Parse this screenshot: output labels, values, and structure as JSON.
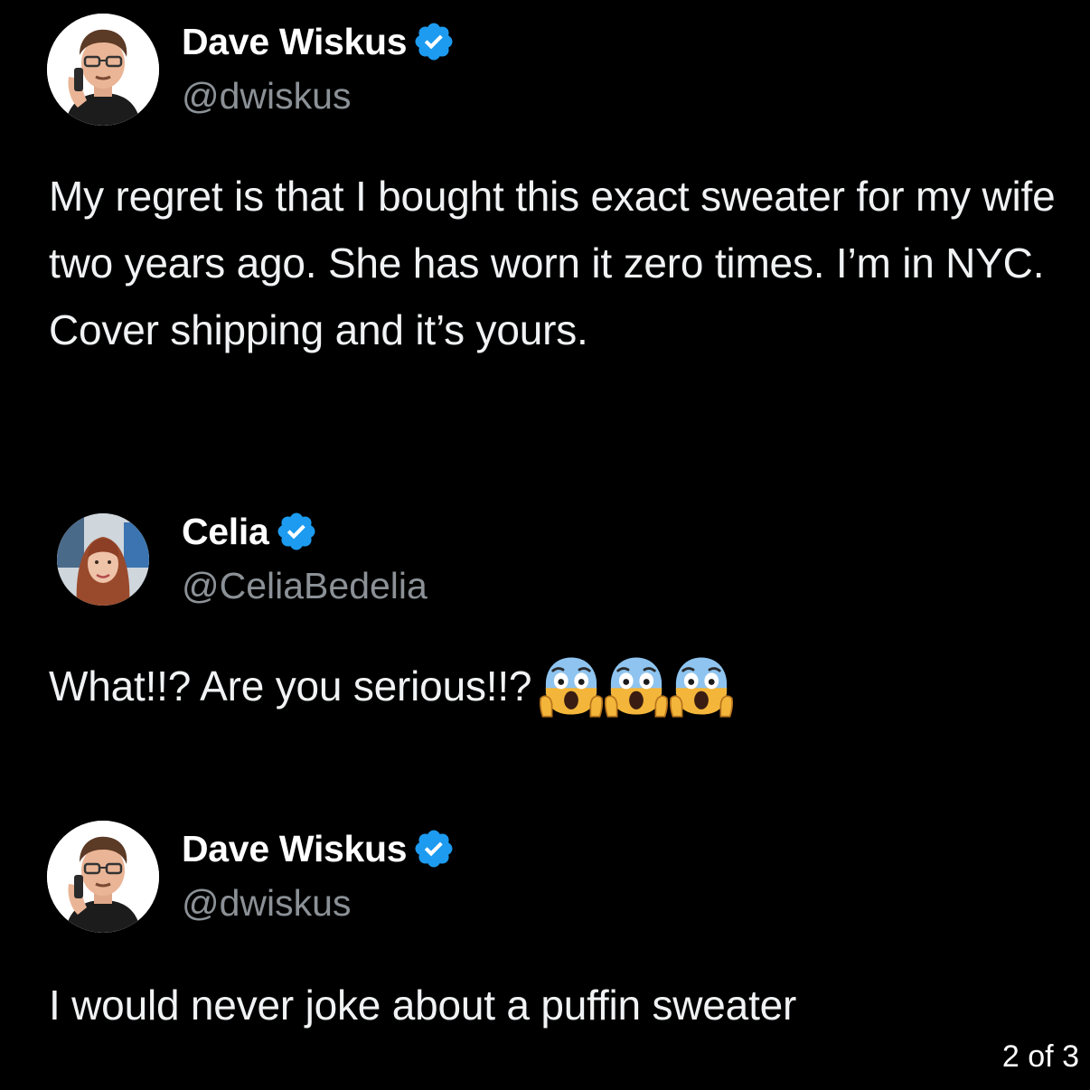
{
  "tweets": [
    {
      "author_name": "Dave Wiskus",
      "handle": "@dwiskus",
      "verified": true,
      "avatar_icon": "man-with-glasses-on-phone-avatar",
      "text": "My regret is that I bought this exact sweater for my wife two years ago. She has worn it zero times. I’m in NYC. Cover shipping and it’s yours."
    },
    {
      "author_name": "Celia",
      "handle": "@CeliaBedelia",
      "verified": true,
      "avatar_icon": "woman-with-red-hair-avatar",
      "text": "What!!? Are you serious!!?",
      "emojis": [
        "face-screaming-in-fear-icon",
        "face-screaming-in-fear-icon",
        "face-screaming-in-fear-icon"
      ]
    },
    {
      "author_name": "Dave Wiskus",
      "handle": "@dwiskus",
      "verified": true,
      "avatar_icon": "man-with-glasses-on-phone-avatar",
      "text": "I would never joke about a puffin sweater"
    }
  ],
  "page_indicator": "2 of 3",
  "colors": {
    "background": "#000000",
    "verified_badge": "#1d9bf0",
    "handle": "#8b9196",
    "text": "#f0f2f3"
  }
}
